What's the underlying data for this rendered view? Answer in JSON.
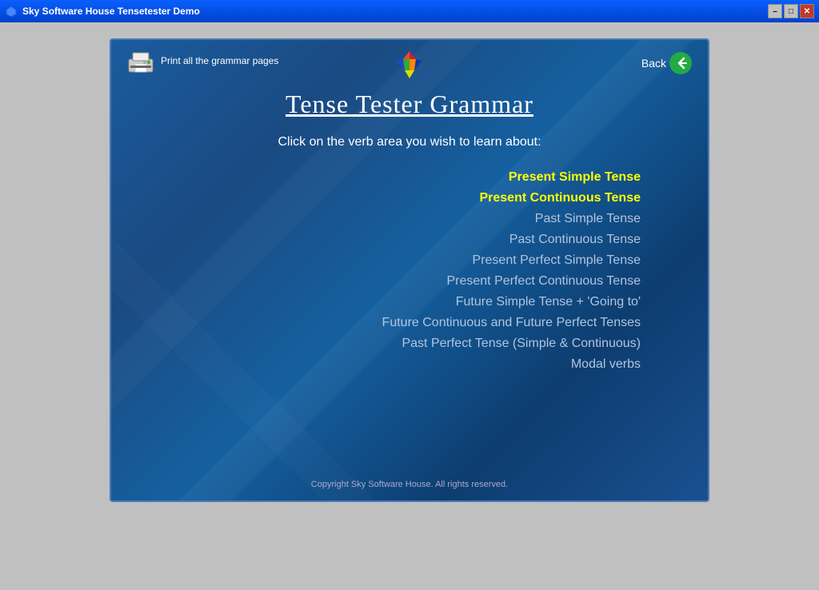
{
  "titleBar": {
    "title": "Sky Software House Tensetester Demo",
    "buttons": {
      "minimize": "–",
      "maximize": "□",
      "close": "✕"
    }
  },
  "panel": {
    "printLabel": "Print all the grammar pages",
    "backLabel": "Back",
    "mainTitle": "Tense Tester Grammar",
    "subtitle": "Click on the verb area you wish to learn about:",
    "menuItems": [
      {
        "label": "Present Simple Tense",
        "style": "yellow"
      },
      {
        "label": "Present Continuous Tense",
        "style": "yellow"
      },
      {
        "label": "Past Simple Tense",
        "style": "normal"
      },
      {
        "label": "Past Continuous Tense",
        "style": "normal"
      },
      {
        "label": "Present Perfect Simple Tense",
        "style": "normal"
      },
      {
        "label": "Present Perfect Continuous Tense",
        "style": "normal"
      },
      {
        "label": "Future Simple Tense + 'Going to'",
        "style": "normal"
      },
      {
        "label": "Future Continuous and Future Perfect Tenses",
        "style": "normal"
      },
      {
        "label": "Past Perfect Tense (Simple & Continuous)",
        "style": "normal"
      },
      {
        "label": "Modal verbs",
        "style": "normal"
      }
    ],
    "copyright": "Copyright Sky Software House. All rights reserved."
  }
}
